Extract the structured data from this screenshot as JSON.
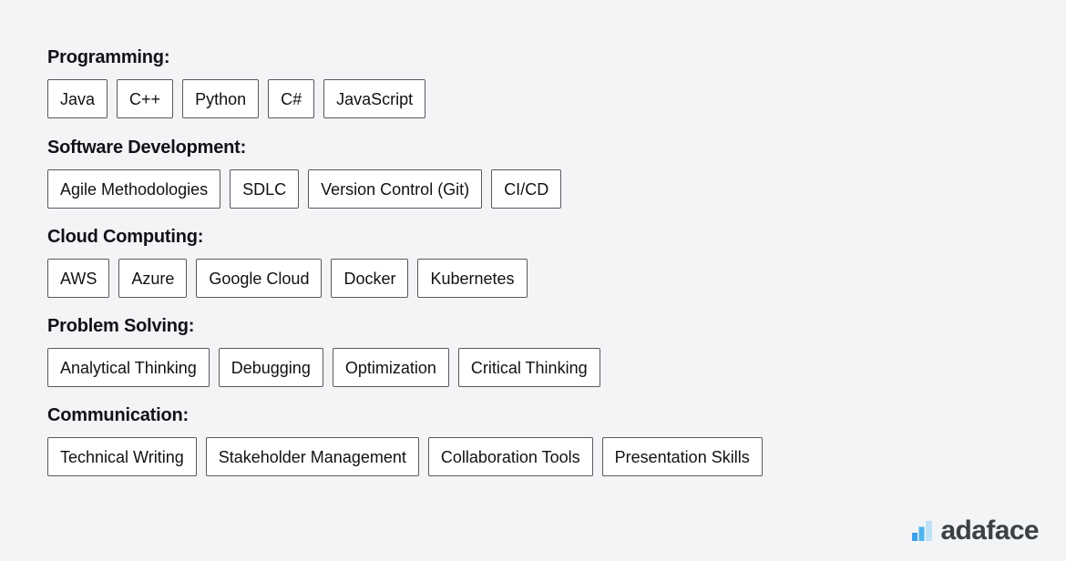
{
  "page": {
    "background_color": "#f3f4f6",
    "text_color": "#111215",
    "chip_background": "#ffffff",
    "chip_border_color": "#57595d"
  },
  "sections": [
    {
      "heading": "Programming:",
      "chips": [
        "Java",
        "C++",
        "Python",
        "C#",
        "JavaScript"
      ]
    },
    {
      "heading": "Software Development:",
      "chips": [
        "Agile Methodologies",
        "SDLC",
        "Version Control (Git)",
        "CI/CD"
      ]
    },
    {
      "heading": "Cloud Computing:",
      "chips": [
        "AWS",
        "Azure",
        "Google Cloud",
        "Docker",
        "Kubernetes"
      ]
    },
    {
      "heading": "Problem Solving:",
      "chips": [
        "Analytical Thinking",
        "Debugging",
        "Optimization",
        "Critical Thinking"
      ]
    },
    {
      "heading": "Communication:",
      "chips": [
        "Technical Writing",
        "Stakeholder Management",
        "Collaboration Tools",
        "Presentation Skills"
      ]
    }
  ],
  "logo": {
    "icon": "bar-chart-icon",
    "text": "adaface",
    "text_color": "#3d4043",
    "bar_colors": [
      "#3ba0e6",
      "#4eb4ee",
      "#bfe2f7"
    ]
  }
}
